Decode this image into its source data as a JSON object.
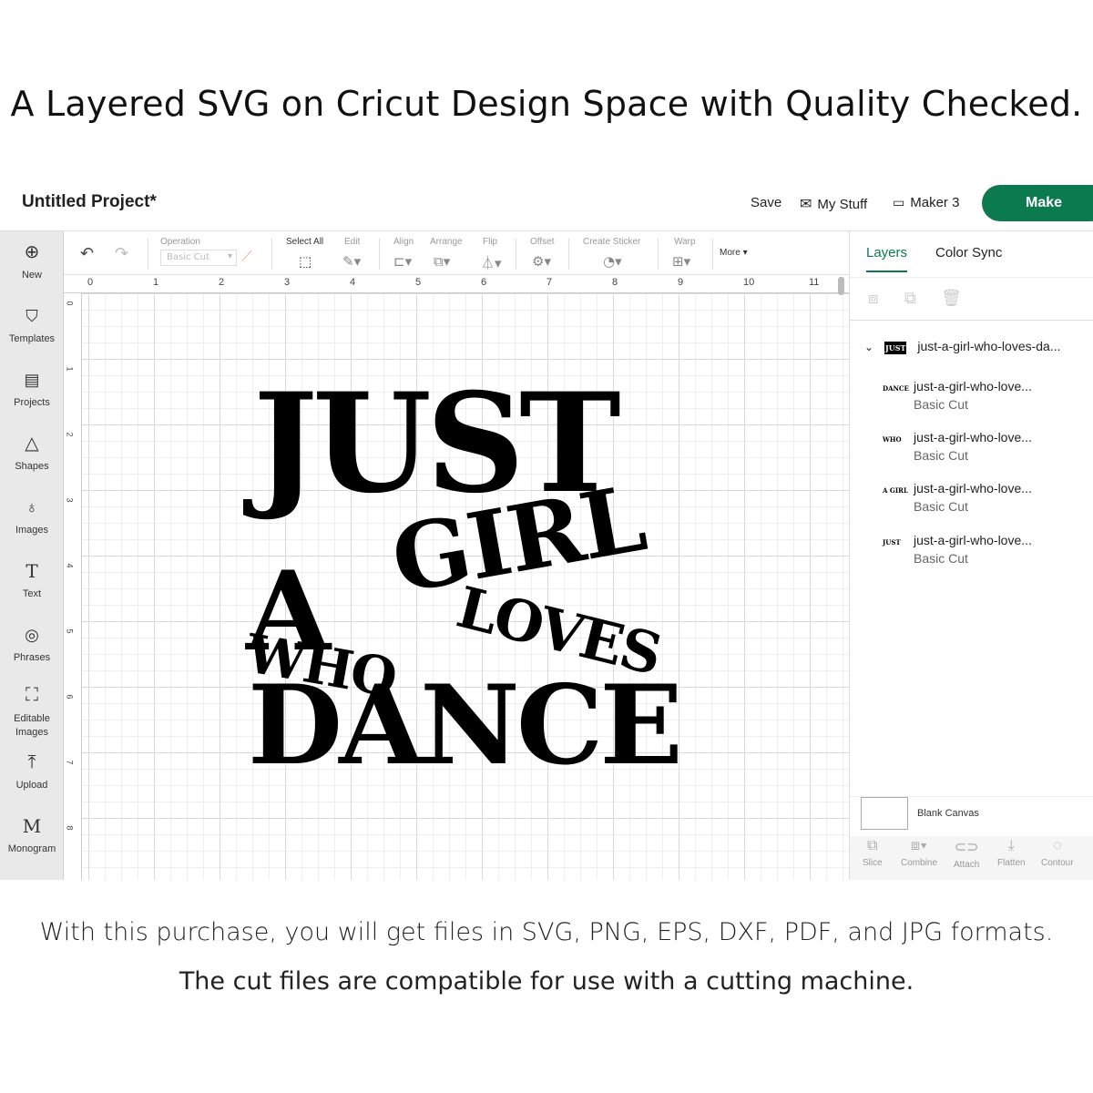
{
  "headline": "A Layered SVG on Cricut Design Space with Quality Checked.",
  "footer": {
    "line1": "With this purchase, you will get files in SVG, PNG, EPS, DXF, PDF, and JPG formats.",
    "line2": "The cut files are compatible for use with a cutting machine."
  },
  "topbar": {
    "project_title": "Untitled Project*",
    "save": "Save",
    "my_stuff": "My Stuff",
    "maker": "Maker 3",
    "make": "Make"
  },
  "leftbar": {
    "items": [
      {
        "label": "New",
        "icon": "plus-circle-icon",
        "glyph": "⊕"
      },
      {
        "label": "Templates",
        "icon": "tshirt-icon",
        "glyph": "👕"
      },
      {
        "label": "Projects",
        "icon": "clipboard-icon",
        "glyph": "📋"
      },
      {
        "label": "Shapes",
        "icon": "shapes-icon",
        "glyph": "△"
      },
      {
        "label": "Images",
        "icon": "lightbulb-icon",
        "glyph": "💡"
      },
      {
        "label": "Text",
        "icon": "text-icon",
        "glyph": "T"
      },
      {
        "label": "Phrases",
        "icon": "speech-bubble-icon",
        "glyph": "💬"
      },
      {
        "label": "Editable Images",
        "icon": "editable-image-icon",
        "glyph": "⛶"
      },
      {
        "label": "Upload",
        "icon": "upload-icon",
        "glyph": "⤒"
      },
      {
        "label": "Monogram",
        "icon": "monogram-icon",
        "glyph": "M"
      }
    ]
  },
  "editbar": {
    "operation_label": "Operation",
    "operation_value": "Basic Cut",
    "select_all": "Select All",
    "edit": "Edit",
    "align": "Align",
    "arrange": "Arrange",
    "flip": "Flip",
    "offset": "Offset",
    "create_sticker": "Create Sticker",
    "warp": "Warp",
    "more": "More"
  },
  "ruler": {
    "top": [
      "0",
      "1",
      "2",
      "3",
      "4",
      "5",
      "6",
      "7",
      "8",
      "9",
      "10",
      "11"
    ],
    "left": [
      "0",
      "1",
      "2",
      "3",
      "4",
      "5",
      "6",
      "7",
      "8"
    ]
  },
  "artwork": {
    "words": [
      "JUST",
      "A",
      "GIRL",
      "WHO",
      "LOVES",
      "DANCE"
    ]
  },
  "rpanel": {
    "tabs": [
      "Layers",
      "Color Sync"
    ],
    "group_name": "just-a-girl-who-loves-da...",
    "group_thumb": "JUST",
    "layers": [
      {
        "name": "just-a-girl-who-love...",
        "op": "Basic Cut",
        "thumb": "DANCE"
      },
      {
        "name": "just-a-girl-who-love...",
        "op": "Basic Cut",
        "thumb": "WHO"
      },
      {
        "name": "just-a-girl-who-love...",
        "op": "Basic Cut",
        "thumb": "A GIRL"
      },
      {
        "name": "just-a-girl-who-love...",
        "op": "Basic Cut",
        "thumb": "JUST"
      }
    ],
    "blank_canvas": "Blank Canvas",
    "bottom_tools": [
      "Slice",
      "Combine",
      "Attach",
      "Flatten",
      "Contour"
    ]
  },
  "colors": {
    "brand": "#0c7a4f",
    "ink": "#000000"
  }
}
